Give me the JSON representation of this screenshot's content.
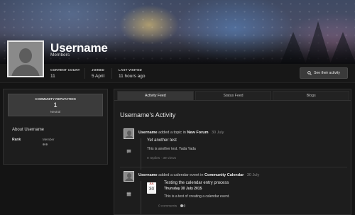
{
  "profile": {
    "username": "Username",
    "group": "Members",
    "stats": [
      {
        "label": "CONTENT COUNT",
        "value": "11"
      },
      {
        "label": "JOINED",
        "value": "5 April"
      },
      {
        "label": "LAST VISITED",
        "value": "11 hours ago"
      }
    ],
    "see_activity_label": "See their activity"
  },
  "sidebar": {
    "reputation_title": "COMMUNITY REPUTATION",
    "reputation_value": "1",
    "reputation_status": "Neutral",
    "about_title": "About Username",
    "rank_label": "Rank",
    "rank_value": "Member",
    "rank_pips": 2
  },
  "tabs": [
    {
      "label": "Activity Feed",
      "active": true
    },
    {
      "label": "Status Feed",
      "active": false
    },
    {
      "label": "Blogs",
      "active": false
    }
  ],
  "activity": {
    "title": "Username's Activity",
    "items": [
      {
        "user": "Username",
        "action": "added a topic in",
        "target": "New Forum",
        "date": "30 July",
        "type_icon": "comment-icon",
        "title": "Yet another test",
        "body": "This is another test. Yada Yada",
        "meta": "0 replies · 39 views"
      },
      {
        "user": "Username",
        "action": "added a calendar event in",
        "target": "Community Calendar",
        "date": "30 July",
        "type_icon": "calendar-icon",
        "cal_month": "JUL",
        "cal_day": "30",
        "title": "Testing the calendar entry process",
        "subtitle": "Thursday 30 July 2015",
        "body": "This is a test of creating a calendar event.",
        "meta": "0 comments",
        "reaction_count": "0"
      }
    ]
  },
  "colors": {
    "page_bg": "#141414",
    "panel_bg": "#1d1d1d",
    "accent_text": "#ffffff",
    "calendar_month": "#c0392b"
  }
}
